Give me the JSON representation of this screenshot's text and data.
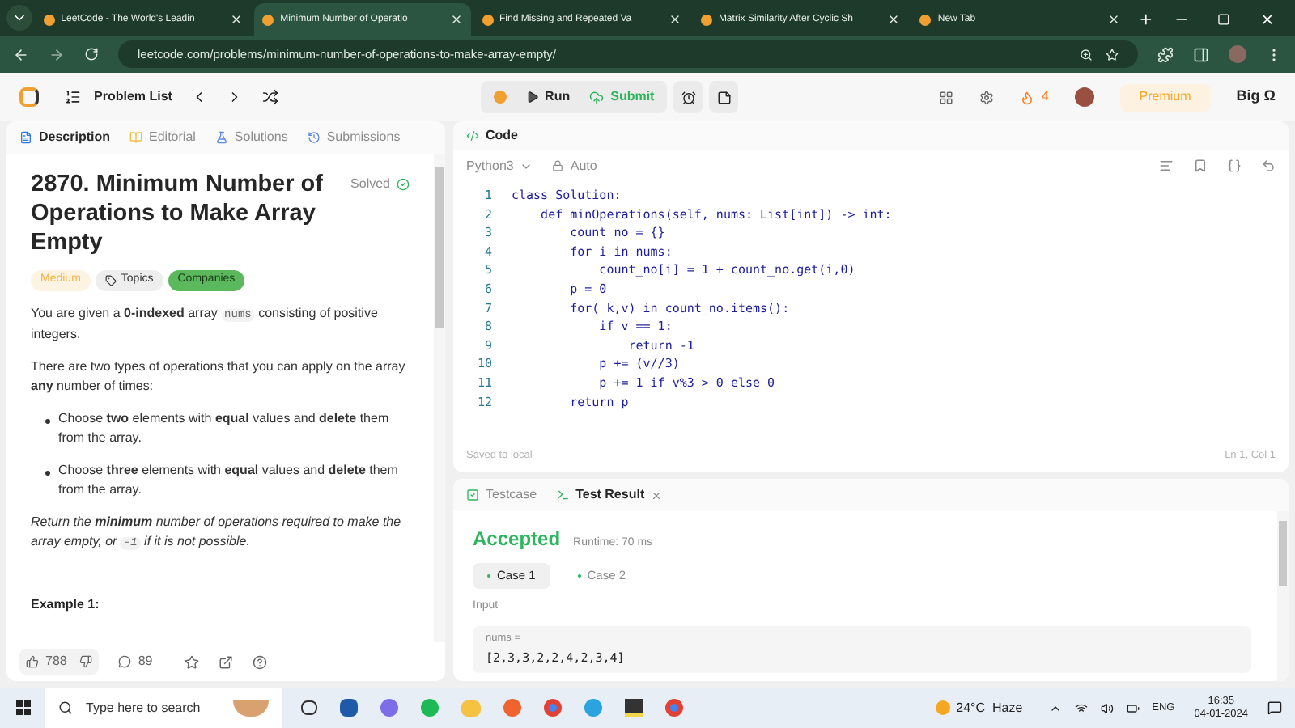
{
  "browser": {
    "tabs": [
      {
        "title": "LeetCode - The World's Leadin",
        "selected": false
      },
      {
        "title": "Minimum Number of Operatio",
        "selected": true
      },
      {
        "title": "Find Missing and Repeated Va",
        "selected": false
      },
      {
        "title": "Matrix Similarity After Cyclic Sh",
        "selected": false
      },
      {
        "title": "New Tab",
        "selected": false
      }
    ],
    "url": "leetcode.com/problems/minimum-number-of-operations-to-make-array-empty/"
  },
  "toolbar": {
    "problem_list": "Problem List",
    "run": "Run",
    "submit": "Submit",
    "streak": "4",
    "premium": "Premium",
    "user": "Big Ω"
  },
  "left_tabs": [
    {
      "label": "Description",
      "selected": true
    },
    {
      "label": "Editorial",
      "selected": false
    },
    {
      "label": "Solutions",
      "selected": false
    },
    {
      "label": "Submissions",
      "selected": false
    }
  ],
  "problem": {
    "title": "2870. Minimum Number of Operations to Make Array Empty",
    "status": "Solved",
    "tags": [
      {
        "label": "Medium",
        "kind": "difficulty"
      },
      {
        "label": "Topics",
        "kind": "topics"
      },
      {
        "label": "Companies",
        "kind": "companies"
      }
    ],
    "paragraphs": [
      [
        {
          "kind": "text",
          "text": "You are given a **0-indexed** array "
        },
        {
          "kind": "code",
          "text": "nums"
        },
        {
          "kind": "text",
          "text": " consisting of positive integers."
        }
      ],
      [
        {
          "kind": "text",
          "text": "There are two types of operations that you can apply on the array **any** number of times:"
        }
      ]
    ],
    "bullets": [
      "Choose **two** elements with **equal** values and **delete** them from the array.",
      "Choose **three** elements with **equal** values and **delete** them from the array."
    ],
    "closing": [
      {
        "kind": "text",
        "text": "Return the **minimum** number of operations required to make the array empty, or "
      },
      {
        "kind": "code",
        "text": "-1"
      },
      {
        "kind": "text",
        "text": " if it is not possible."
      }
    ],
    "example_heading": "Example 1:"
  },
  "footer": {
    "likes": "788",
    "comments": "89"
  },
  "code_panel": {
    "title": "Code",
    "language": "Python3",
    "mode": "Auto",
    "lines": [
      {
        "n": "1",
        "text": "class Solution:"
      },
      {
        "n": "2",
        "text": "    def minOperations(self, nums: List[int]) -> int:"
      },
      {
        "n": "3",
        "text": "        count_no = {}"
      },
      {
        "n": "4",
        "text": "        for i in nums:"
      },
      {
        "n": "5",
        "text": "            count_no[i] = 1 + count_no.get(i,0)"
      },
      {
        "n": "6",
        "text": "        p = 0"
      },
      {
        "n": "7",
        "text": "        for( k,v) in count_no.items():"
      },
      {
        "n": "8",
        "text": "            if v == 1:"
      },
      {
        "n": "9",
        "text": "                return -1"
      },
      {
        "n": "10",
        "text": "            p += (v//3)"
      },
      {
        "n": "11",
        "text": "            p += 1 if v%3 > 0 else 0"
      },
      {
        "n": "12",
        "text": "        return p"
      }
    ],
    "saved": "Saved to local",
    "cursor": "Ln 1, Col 1"
  },
  "result_panel": {
    "tabs": [
      {
        "label": "Testcase",
        "selected": false
      },
      {
        "label": "Test Result",
        "selected": true
      }
    ],
    "verdict": "Accepted",
    "runtime": "Runtime: 70 ms",
    "cases": [
      {
        "label": "Case 1",
        "selected": true
      },
      {
        "label": "Case 2",
        "selected": false
      }
    ],
    "input_label": "Input",
    "var_name": "nums =",
    "var_value": "[2,3,3,2,2,4,2,3,4]"
  },
  "taskbar": {
    "search_placeholder": "Type here to search",
    "weather": "24°C  Haze",
    "lang": "ENG",
    "time": "16:35",
    "date": "04-01-2024"
  }
}
